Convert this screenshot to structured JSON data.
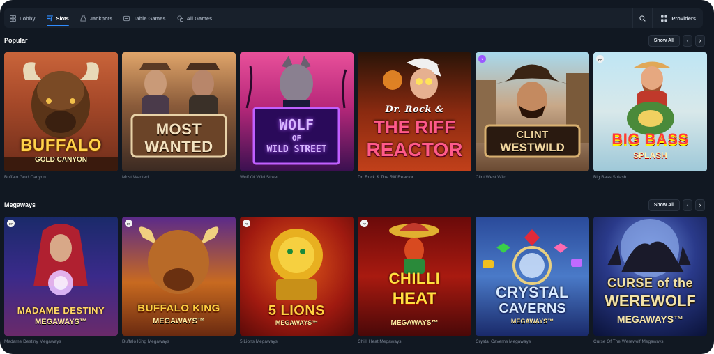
{
  "nav": {
    "tabs": [
      {
        "label": "Lobby",
        "icon": "lobby-icon",
        "active": false
      },
      {
        "label": "Slots",
        "icon": "slots-icon",
        "active": true
      },
      {
        "label": "Jackpots",
        "icon": "jackpots-icon",
        "active": false
      },
      {
        "label": "Table Games",
        "icon": "table-games-icon",
        "active": false
      },
      {
        "label": "All Games",
        "icon": "all-games-icon",
        "active": false
      }
    ],
    "providers_label": "Providers",
    "search_icon": "search-icon"
  },
  "sections": {
    "popular": {
      "title": "Popular",
      "show_all": "Show All",
      "games": [
        {
          "name": "Buffalo Gold Canyon",
          "art_title": "BUFFALO",
          "art_sub": "GOLD CANYON",
          "badge": ""
        },
        {
          "name": "Most Wanted",
          "art_title": "MOST",
          "art_sub": "WANTED",
          "badge": ""
        },
        {
          "name": "Wolf Of Wild Street",
          "art_title": "WOLF",
          "art_sub": "OF",
          "art_sub2": "WILD STREET",
          "badge": ""
        },
        {
          "name": "Dr. Rock & The Riff Reactor",
          "art_title": "Dr. Rock &",
          "art_sub": "THE RIFF",
          "art_sub2": "REACTOR",
          "badge": ""
        },
        {
          "name": "Clint West Wild",
          "art_title": "CLINT",
          "art_sub": "WESTWILD",
          "badge": "heart"
        },
        {
          "name": "Big Bass Splash",
          "art_title": "BIG BASS",
          "art_sub": "SPLASH",
          "badge": "pp"
        }
      ]
    },
    "megaways": {
      "title": "Megaways",
      "show_all": "Show All",
      "games": [
        {
          "name": "Madame Destiny Megaways",
          "art_title": "MADAME DESTINY",
          "art_sub": "MEGAWAYS™",
          "badge": "pp"
        },
        {
          "name": "Buffalo King Megaways",
          "art_title": "BUFFALO KING",
          "art_sub": "MEGAWAYS™",
          "badge": "pp"
        },
        {
          "name": "5 Lions Megaways",
          "art_title": "5 LIONS",
          "art_sub": "MEGAWAYS™",
          "badge": "pp"
        },
        {
          "name": "Chilli Heat Megaways",
          "art_title": "CHILLI",
          "art_sub": "HEAT",
          "art_sub2": "MEGAWAYS™",
          "badge": "pp"
        },
        {
          "name": "Crystal Caverns Megaways",
          "art_title": "CRYSTAL",
          "art_sub": "CAVERNS",
          "art_sub2": "MEGAWAYS™",
          "badge": ""
        },
        {
          "name": "Curse Of The Werewolf Megaways",
          "art_title": "CURSE of the",
          "art_sub": "WEREWOLF",
          "art_sub2": "MEGAWAYS™",
          "badge": ""
        }
      ]
    }
  },
  "colors": {
    "background": "#111822",
    "accent": "#2f8cff"
  }
}
